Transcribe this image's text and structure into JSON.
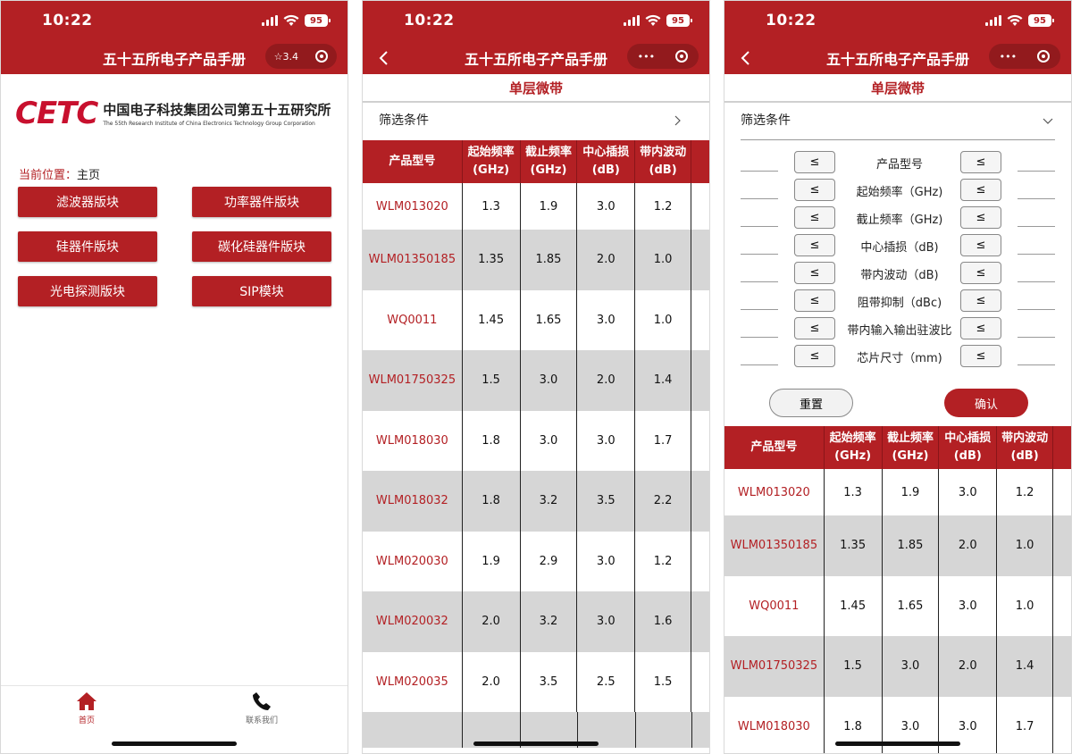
{
  "status": {
    "time": "10:22",
    "battery": "95"
  },
  "nav": {
    "title": "五十五所电子产品手册",
    "rating": "☆3.4",
    "more": "•••"
  },
  "home": {
    "logo_mark": "CETC",
    "org_cn": "中国电子科技集团公司第五十五研究所",
    "org_en": "The 55th Research Institute of China Electronics Technology Group Corporation",
    "location_label": "当前位置：",
    "location_value": "主页",
    "buttons": [
      "滤波器版块",
      "功率器件版块",
      "硅器件版块",
      "碳化硅器件版块",
      "光电探测版块",
      "SIP模块"
    ],
    "tabs": [
      "首页",
      "联系我们"
    ]
  },
  "list": {
    "subtitle": "单层微带",
    "filter_label": "筛选条件",
    "headers": [
      {
        "line1": "产品型号",
        "line2": ""
      },
      {
        "line1": "起始频率",
        "line2": "(GHz)"
      },
      {
        "line1": "截止频率",
        "line2": "(GHz)"
      },
      {
        "line1": "中心插损",
        "line2": "(dB)"
      },
      {
        "line1": "带内波动",
        "line2": "(dB)"
      }
    ],
    "rows": [
      [
        "WLM013020",
        "1.3",
        "1.9",
        "3.0",
        "1.2"
      ],
      [
        "WLM01350185",
        "1.35",
        "1.85",
        "2.0",
        "1.0"
      ],
      [
        "WQ0011",
        "1.45",
        "1.65",
        "3.0",
        "1.0"
      ],
      [
        "WLM01750325",
        "1.5",
        "3.0",
        "2.0",
        "1.4"
      ],
      [
        "WLM018030",
        "1.8",
        "3.0",
        "3.0",
        "1.7"
      ],
      [
        "WLM018032",
        "1.8",
        "3.2",
        "3.5",
        "2.2"
      ],
      [
        "WLM020030",
        "1.9",
        "2.9",
        "3.0",
        "1.2"
      ],
      [
        "WLM020032",
        "2.0",
        "3.2",
        "3.0",
        "1.6"
      ],
      [
        "WLM020035",
        "2.0",
        "3.5",
        "2.5",
        "1.5"
      ]
    ]
  },
  "filter_form": {
    "op": "≤",
    "fields": [
      "产品型号",
      "起始频率（GHz)",
      "截止频率（GHz)",
      "中心插损（dB)",
      "带内波动（dB)",
      "阻带抑制（dBc)",
      "带内输入输出驻波比",
      "芯片尺寸（mm)"
    ],
    "reset": "重置",
    "confirm": "确认"
  },
  "colors": {
    "brand": "#b32024",
    "row_alt": "#d6d6d6"
  }
}
